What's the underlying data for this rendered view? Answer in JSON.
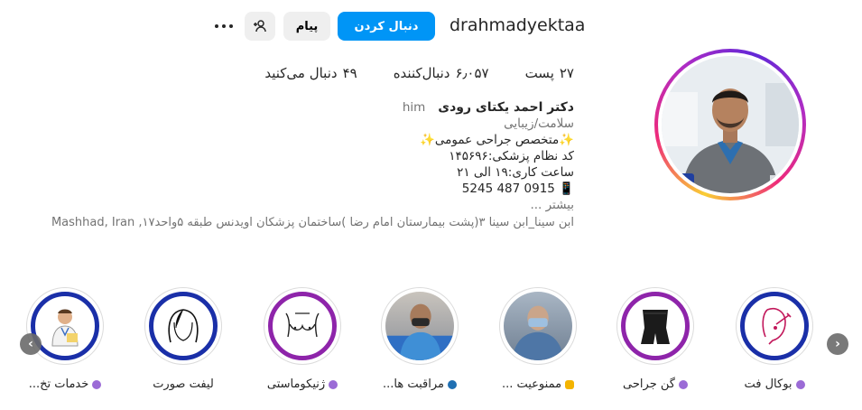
{
  "profile": {
    "username": "drahmadyektaa",
    "follow_label": "دنبال کردن",
    "message_label": "پیام",
    "stats": {
      "posts": {
        "value": "۲۷",
        "label": "پست"
      },
      "followers": {
        "value": "۶٫۰۵۷",
        "label": "دنبال‌کننده"
      },
      "following": {
        "value": "۴۹",
        "label": "دنبال می‌کنید"
      }
    },
    "bio": {
      "name": "دکتر احمد یکتای رودی",
      "pronoun": "him",
      "category": "سلامت/زیبایی",
      "line1": "✨متخصص جراحی عمومی✨",
      "line2": "کد نظام پزشکی:۱۴۵۶۹۶",
      "line3": "ساعت کاری:۱۹ الی ۲۱",
      "line4": "📱 0915 487 5245",
      "more": "بیشتر ...",
      "address": "ابن سینا_ابن سینا ۳(پشت بیمارستان امام رضا )ساختمان پزشکان اویدنس طبقه ۵واحد۱۷, Mashhad, Iran"
    }
  },
  "highlights": [
    {
      "label": "بوکال فت",
      "dot": "#9b6bd6"
    },
    {
      "label": "گن جراحی",
      "dot": "#9b6bd6"
    },
    {
      "label": "ممنوعیت ...",
      "dot": "#f4b400",
      "dot_shape": "hand"
    },
    {
      "label": "مراقبت ها...",
      "dot": "#1f6fb2"
    },
    {
      "label": "ژنیکوماستی",
      "dot": "#9b6bd6"
    },
    {
      "label": "لیفت صورت",
      "dot": ""
    },
    {
      "label": "خدمات تخ...",
      "dot": "#9b6bd6"
    }
  ],
  "colors": {
    "accent": "#0095f6",
    "ring_blue": "#1a2fa8",
    "ring_purple": "#8e24aa"
  }
}
